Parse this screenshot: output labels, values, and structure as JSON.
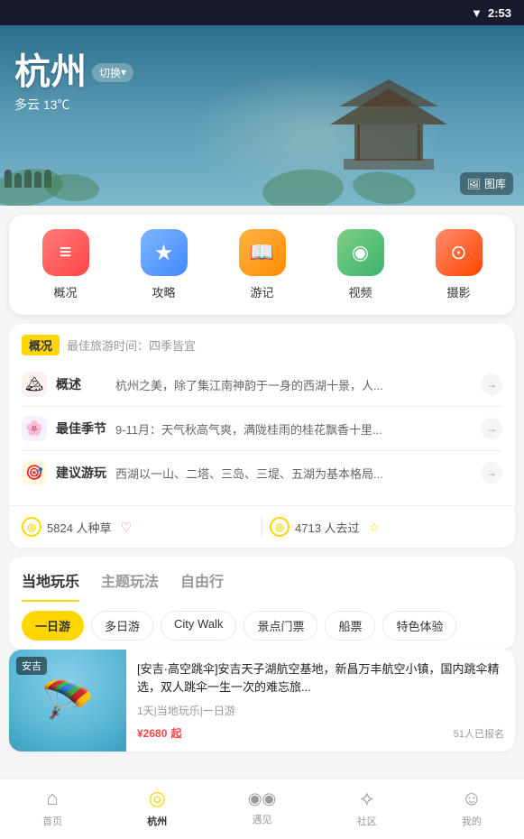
{
  "statusBar": {
    "time": "2:53",
    "wifiIcon": "▼"
  },
  "hero": {
    "cityName": "杭州",
    "switchLabel": "切换",
    "switchArrow": "▾",
    "weather": "多云",
    "temperature": "13℃",
    "galleryIcon": "🖼",
    "galleryLabel": "图库"
  },
  "quickNav": {
    "items": [
      {
        "id": "overview",
        "label": "概况",
        "icon": "≡",
        "colorClass": "icon-overview"
      },
      {
        "id": "guide",
        "label": "攻略",
        "icon": "★",
        "colorClass": "icon-guide"
      },
      {
        "id": "diary",
        "label": "游记",
        "icon": "📖",
        "colorClass": "icon-diary"
      },
      {
        "id": "video",
        "label": "视频",
        "icon": "◉",
        "colorClass": "icon-video"
      },
      {
        "id": "photo",
        "label": "摄影",
        "icon": "⊙",
        "colorClass": "icon-photo"
      }
    ]
  },
  "overviewSection": {
    "badge": "概况",
    "subtitle": "最佳旅游时间：四季皆宜",
    "rows": [
      {
        "iconColor": "icon-red",
        "iconEmoji": "🏔",
        "title": "概述",
        "desc": "杭州之美，除了集江南神韵于一身的西湖十景，人..."
      },
      {
        "iconColor": "icon-purple",
        "iconEmoji": "🌸",
        "title": "最佳季节",
        "desc": "9-11月：天气秋高气爽，满陇桂雨的桂花飘香十里..."
      },
      {
        "iconColor": "icon-orange",
        "iconEmoji": "🎯",
        "title": "建议游玩",
        "desc": "西湖以一山、二塔、三岛、三堤、五湖为基本格局..."
      }
    ],
    "stats": {
      "wantGo": {
        "count": "5824",
        "unit": "人种草",
        "icon": "♡"
      },
      "visited": {
        "count": "4713",
        "unit": "人去过",
        "icon": "☆"
      }
    }
  },
  "tabSection": {
    "mainTabs": [
      {
        "id": "local",
        "label": "当地玩乐",
        "active": true
      },
      {
        "id": "theme",
        "label": "主题玩法",
        "active": false
      },
      {
        "id": "free",
        "label": "自由行",
        "active": false
      }
    ],
    "filterChips": [
      {
        "id": "day1",
        "label": "一日游",
        "active": true
      },
      {
        "id": "multiday",
        "label": "多日游",
        "active": false
      },
      {
        "id": "citywalk",
        "label": "City Walk",
        "active": false
      },
      {
        "id": "tickets",
        "label": "景点门票",
        "active": false
      },
      {
        "id": "boat",
        "label": "船票",
        "active": false
      },
      {
        "id": "special",
        "label": "特色体验",
        "active": false
      }
    ]
  },
  "activityCard": {
    "tag": "安吉",
    "title": "[安吉·高空跳伞]安吉天子湖航空基地，新昌万丰航空小镇，国内跳伞精选，双人跳伞一生一次的难忘旅...",
    "meta": "1天|当地玩乐|一日游",
    "price": "¥2680",
    "priceUnit": "起",
    "signupCount": "51人已报名",
    "emoji": "🪂"
  },
  "bottomNav": {
    "tabs": [
      {
        "id": "home",
        "label": "首页",
        "icon": "⌂",
        "active": false
      },
      {
        "id": "hangzhou",
        "label": "杭州",
        "icon": "◎",
        "active": true
      },
      {
        "id": "encounter",
        "label": "遇见",
        "icon": "((o))",
        "active": false
      },
      {
        "id": "community",
        "label": "社区",
        "icon": "⟡",
        "active": false
      },
      {
        "id": "mine",
        "label": "我的",
        "icon": "☺",
        "active": false
      }
    ]
  }
}
